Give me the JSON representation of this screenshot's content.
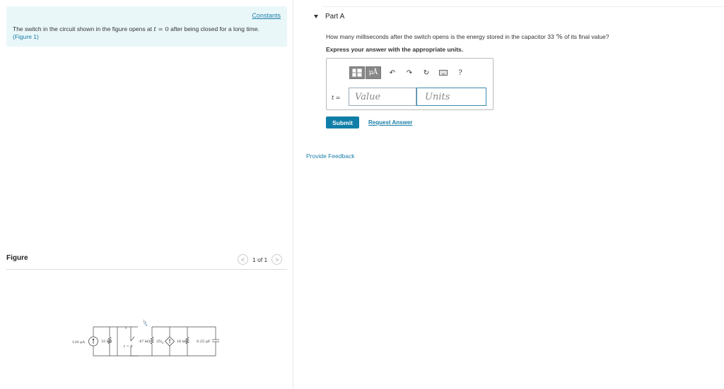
{
  "left": {
    "constants_link": "Constants",
    "problem_text_prefix": "The switch in the circuit shown in the figure opens at ",
    "problem_var": "t",
    "problem_eq": " = 0",
    "problem_text_suffix": " after being closed for a long time.",
    "figure_link": "(Figure 1)",
    "figure_header": "Figure",
    "figure_prev": "<",
    "figure_count": "1 of 1",
    "figure_next": ">"
  },
  "circuit": {
    "source_current": "120 μA",
    "r1": "33 kΩ",
    "r2": "47 kΩ",
    "dependent_source": "25i",
    "dependent_source_sub": "Δ",
    "r3": "16 kΩ",
    "capacitor": "0.25 μF",
    "switch_time": "t = 0",
    "current_label": "i",
    "current_label_sub": "Δ"
  },
  "right": {
    "part_title": "Part A",
    "question_prefix": "How many milliseconds after the switch opens is the energy stored in the capacitor 33",
    "question_pct": " %",
    "question_suffix": " of its final value?",
    "instruction": "Express your answer with the appropriate units.",
    "toolbar": {
      "units_button": "μÅ",
      "undo_icon": "↶",
      "redo_icon": "↷",
      "reset_icon": "↻",
      "help_icon": "?"
    },
    "answer_var": "t",
    "answer_eq": " =",
    "value_placeholder": "Value",
    "units_placeholder": "Units",
    "submit_label": "Submit",
    "request_answer": "Request Answer",
    "provide_feedback": "Provide Feedback"
  }
}
